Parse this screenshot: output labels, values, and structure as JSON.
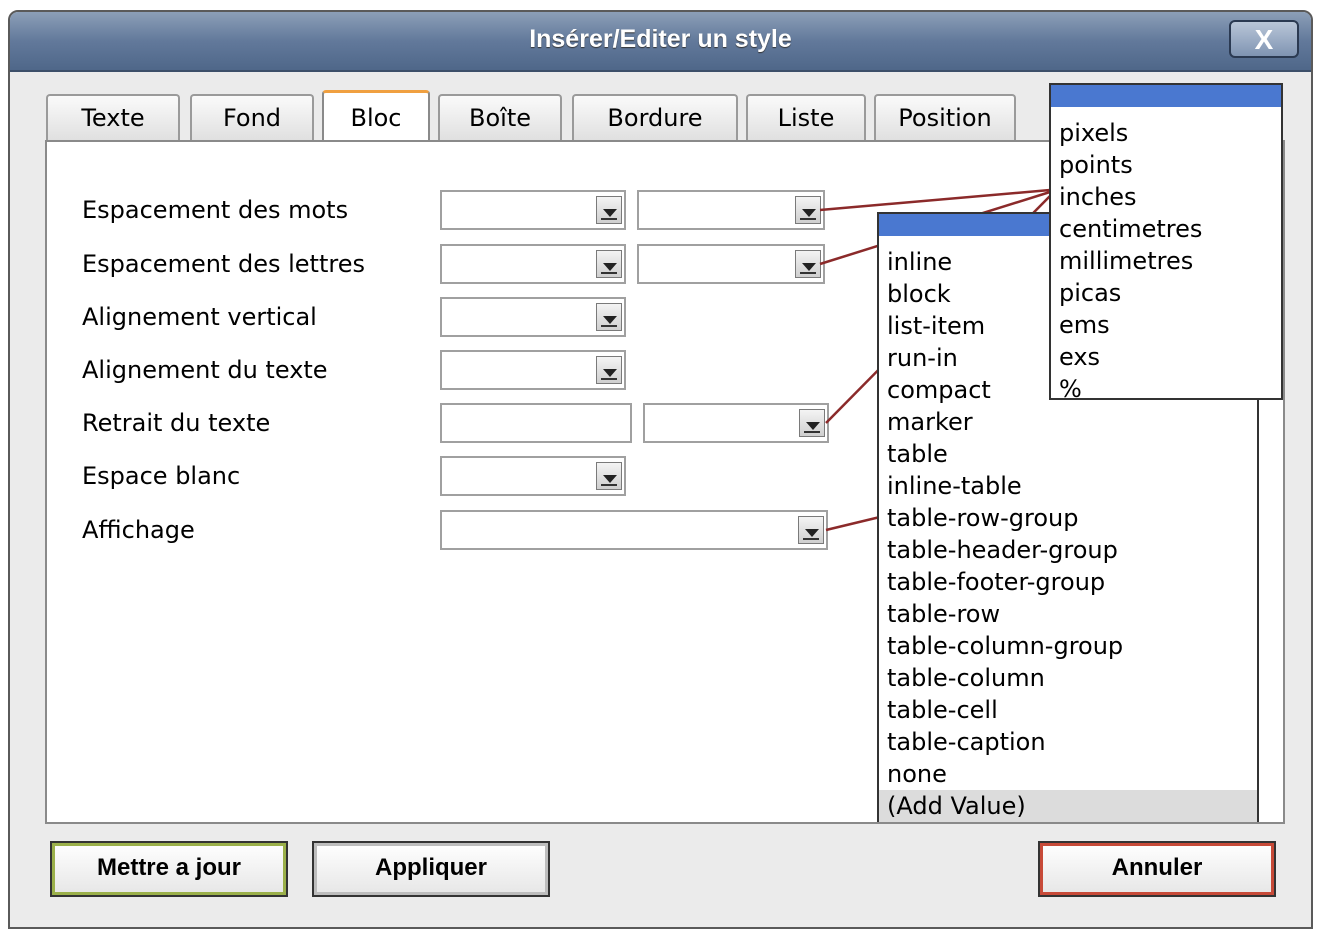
{
  "dialog": {
    "title": "Insérer/Editer un style",
    "close_label": "X"
  },
  "tabs": [
    {
      "label": "Texte"
    },
    {
      "label": "Fond"
    },
    {
      "label": "Bloc"
    },
    {
      "label": "Boîte"
    },
    {
      "label": "Bordure"
    },
    {
      "label": "Liste"
    },
    {
      "label": "Position"
    }
  ],
  "active_tab": "Bloc",
  "form": {
    "word_spacing_label": "Espacement des mots",
    "letter_spacing_label": "Espacement des lettres",
    "vertical_align_label": "Alignement vertical",
    "text_align_label": "Alignement du texte",
    "text_indent_label": "Retrait du texte",
    "white_space_label": "Espace blanc",
    "display_label": "Affichage"
  },
  "units_dropdown": {
    "options": [
      "pixels",
      "points",
      "inches",
      "centimetres",
      "millimetres",
      "picas",
      "ems",
      "exs",
      "%"
    ]
  },
  "display_dropdown": {
    "options": [
      "inline",
      "block",
      "list-item",
      "run-in",
      "compact",
      "marker",
      "table",
      "inline-table",
      "table-row-group",
      "table-header-group",
      "table-footer-group",
      "table-row",
      "table-column-group",
      "table-column",
      "table-cell",
      "table-caption",
      "none",
      "(Add Value)"
    ]
  },
  "buttons": {
    "update": "Mettre a jour",
    "apply": "Appliquer",
    "cancel": "Annuler"
  },
  "colors": {
    "titlebar": "#62799b",
    "connector": "#8b2a2a",
    "highlight": "#4a78d0"
  }
}
